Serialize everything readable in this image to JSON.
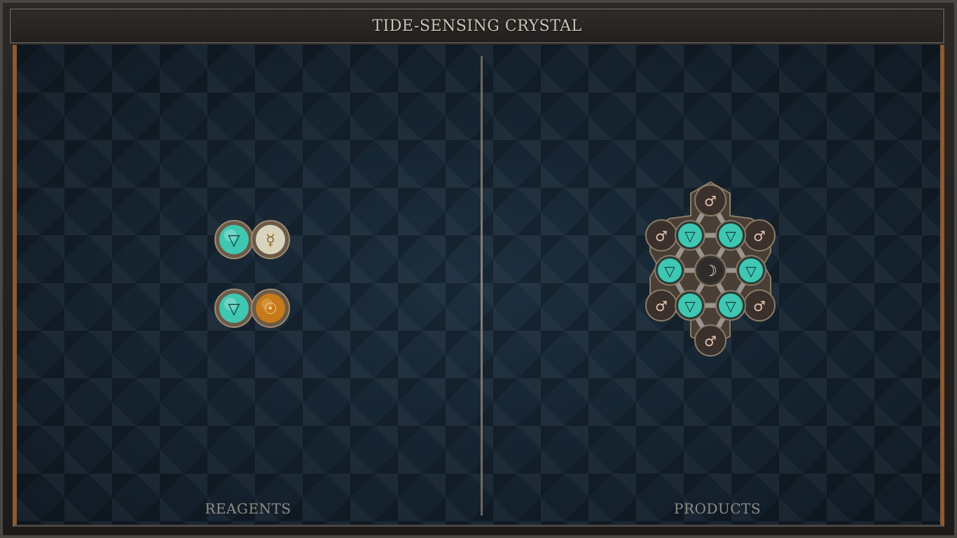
{
  "title": "TIDE-SENSING CRYSTAL",
  "reagents_label": "REAGENTS",
  "products_label": "PRODUCTS",
  "glyphs": {
    "water": "▽",
    "quicksilver": "☿",
    "gold": "☉",
    "iron": "♂",
    "silver": "☽"
  },
  "colors": {
    "water": "#3fc7b2",
    "quicksilver": "#d8d3bd",
    "gold": "#c77a1a",
    "iron": "#4a3a36",
    "silver": "#3a3633",
    "frame_accent": "#8a5a34"
  }
}
